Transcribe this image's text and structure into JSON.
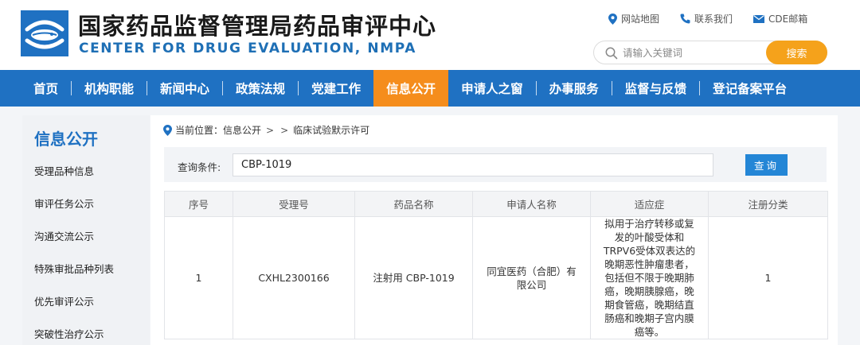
{
  "header": {
    "title_cn": "国家药品监督管理局药品审评中心",
    "title_en": "CENTER FOR DRUG EVALUATION, NMPA",
    "toplinks": {
      "sitemap": "网站地图",
      "contact": "联系我们",
      "mail": "CDE邮箱"
    },
    "search": {
      "placeholder": "请输入关键词",
      "button": "搜索"
    }
  },
  "nav": {
    "items": [
      "首页",
      "机构职能",
      "新闻中心",
      "政策法规",
      "党建工作",
      "信息公开",
      "申请人之窗",
      "办事服务",
      "监督与反馈",
      "登记备案平台"
    ],
    "active": "信息公开"
  },
  "sidebar": {
    "title": "信息公开",
    "items": [
      "受理品种信息",
      "审评任务公示",
      "沟通交流公示",
      "特殊审批品种列表",
      "优先审评公示",
      "突破性治疗公示"
    ]
  },
  "breadcrumb": {
    "label": "当前位置：信息公开",
    "sep1": ">",
    "sep2": ">",
    "current": "临床试验默示许可"
  },
  "query": {
    "label": "查询条件:",
    "value": "CBP-1019",
    "button": "查询"
  },
  "table": {
    "headers": [
      "序号",
      "受理号",
      "药品名称",
      "申请人名称",
      "适应症",
      "注册分类"
    ],
    "rows": [
      [
        "1",
        "CXHL2300166",
        "注射用 CBP-1019",
        "同宜医药（合肥）有限公司",
        "拟用于治疗转移或复发的叶酸受体和TRPV6受体双表达的晚期恶性肿瘤患者，包括但不限于晚期肺癌，晚期胰腺癌，晚期食管癌，晚期结直肠癌和晚期子宫内膜癌等。",
        "1"
      ]
    ]
  },
  "colors": {
    "nav_blue": "#1f71c2",
    "nav_active": "#f58d1c",
    "search_button": "#f5a21b",
    "query_button": "#2486d6",
    "title_en": "#1e6fb5"
  }
}
